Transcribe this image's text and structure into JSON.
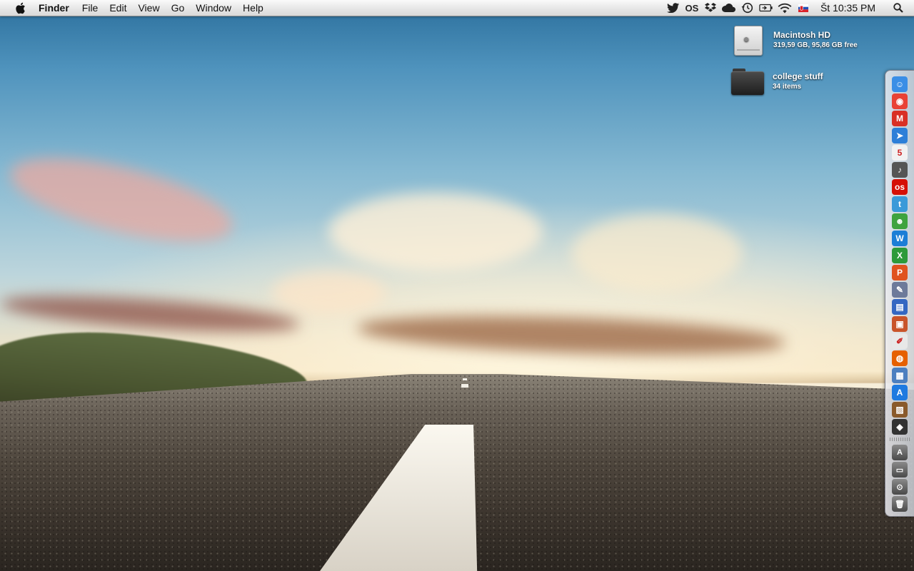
{
  "menubar": {
    "apple_icon": "apple-logo-icon",
    "app_name": "Finder",
    "menus": [
      "File",
      "Edit",
      "View",
      "Go",
      "Window",
      "Help"
    ],
    "status_icons": [
      "twitter-icon",
      "lastfm-icon",
      "dropbox-icon",
      "icloud-icon",
      "time-machine-icon",
      "battery-icon",
      "wifi-icon",
      "input-flag-icon"
    ],
    "lastfm_text": "OS",
    "clock": "Št 10:35 PM",
    "spotlight_icon": "spotlight-search-icon"
  },
  "desktop": {
    "items": [
      {
        "label": "Macintosh HD",
        "sub": "319,59 GB, 95,86 GB free",
        "icon": "hard-drive-icon"
      },
      {
        "label": "college stuff",
        "sub": "34 items",
        "icon": "folder-icon"
      }
    ]
  },
  "dock": {
    "apps": [
      {
        "name": "finder-icon",
        "color": "#3a8ee6",
        "glyph": "☺"
      },
      {
        "name": "chrome-icon",
        "color": "#e94235",
        "glyph": "◉"
      },
      {
        "name": "gmail-icon",
        "color": "#d93025",
        "glyph": "M"
      },
      {
        "name": "sparrow-icon",
        "color": "#2d7fd8",
        "glyph": "➤"
      },
      {
        "name": "ical-icon",
        "color": "#f2f2f2",
        "glyph": "5"
      },
      {
        "name": "itunes-icon",
        "color": "#555555",
        "glyph": "♪"
      },
      {
        "name": "lastfm-icon",
        "color": "#d51007",
        "glyph": "os"
      },
      {
        "name": "twitter-icon",
        "color": "#3a9ad9",
        "glyph": "t"
      },
      {
        "name": "adium-icon",
        "color": "#3fa33f",
        "glyph": "☻"
      },
      {
        "name": "word-icon",
        "color": "#1c7ed6",
        "glyph": "W"
      },
      {
        "name": "excel-icon",
        "color": "#2c9a3a",
        "glyph": "X"
      },
      {
        "name": "powerpoint-icon",
        "color": "#e0531f",
        "glyph": "P"
      },
      {
        "name": "xcode-icon",
        "color": "#6d7a9a",
        "glyph": "✎"
      },
      {
        "name": "keynote-icon",
        "color": "#3467c2",
        "glyph": "▤"
      },
      {
        "name": "photo-booth-icon",
        "color": "#c9542a",
        "glyph": "▣"
      },
      {
        "name": "textedit-icon",
        "color": "#e8e8e8",
        "glyph": "✐"
      },
      {
        "name": "firefox-icon",
        "color": "#e66000",
        "glyph": "◍"
      },
      {
        "name": "preview-icon",
        "color": "#4c7fc0",
        "glyph": "▦"
      },
      {
        "name": "app-store-icon",
        "color": "#1f7ae0",
        "glyph": "A"
      },
      {
        "name": "archive-utility-icon",
        "color": "#8a5a2b",
        "glyph": "▨"
      },
      {
        "name": "activity-monitor-icon",
        "color": "#333333",
        "glyph": "◆"
      }
    ],
    "stacks": [
      {
        "name": "applications-stack-icon",
        "glyph": "A"
      },
      {
        "name": "documents-stack-icon",
        "glyph": "▭"
      },
      {
        "name": "downloads-stack-icon",
        "glyph": "⊙"
      },
      {
        "name": "trash-icon",
        "glyph": "🗑"
      }
    ]
  }
}
